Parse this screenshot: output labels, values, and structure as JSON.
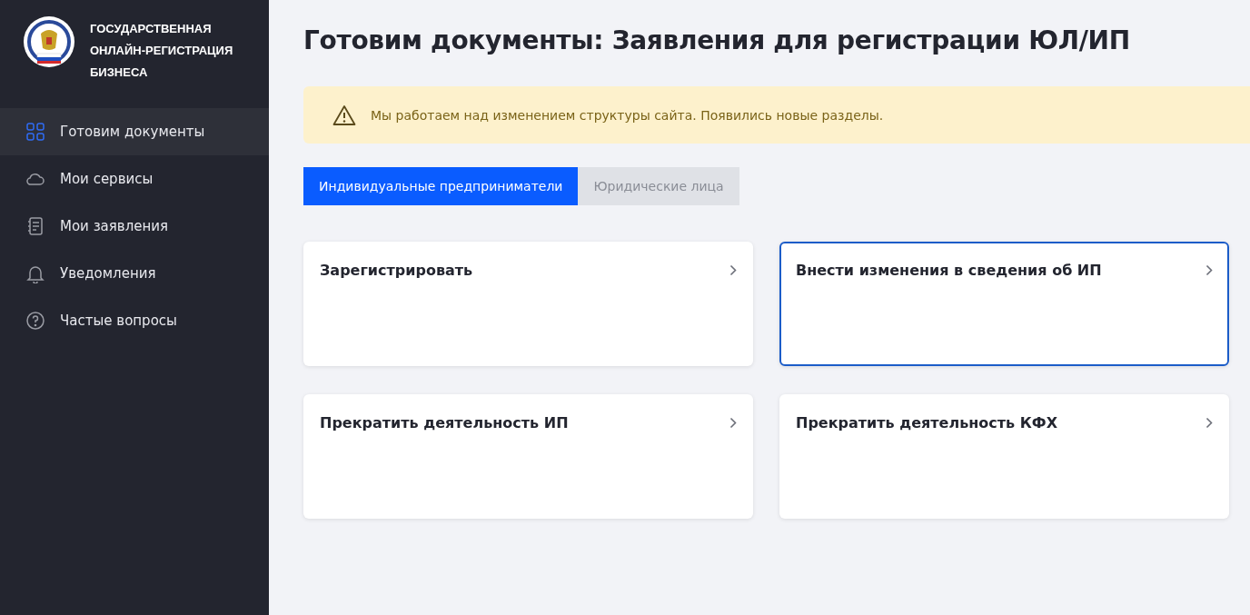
{
  "sidebar": {
    "logo_text": "ГОСУДАРСТВЕННАЯ ОНЛАЙН-РЕГИСТРАЦИЯ БИЗНЕСА",
    "items": [
      {
        "label": "Готовим документы",
        "selected": true
      },
      {
        "label": "Мои сервисы",
        "selected": false
      },
      {
        "label": "Мои заявления",
        "selected": false
      },
      {
        "label": "Уведомления",
        "selected": false
      },
      {
        "label": "Частые вопросы",
        "selected": false
      }
    ]
  },
  "page_title": "Готовим документы: Заявления для регистрации ЮЛ/ИП",
  "notice": "Мы работаем над изменением структуры сайта. Появились новые разделы.",
  "tabs": [
    {
      "label": "Индивидуальные предприниматели",
      "selected": true
    },
    {
      "label": "Юридические лица",
      "selected": false
    }
  ],
  "cards": [
    {
      "title": "Зарегистрировать",
      "highlighted": false
    },
    {
      "title": "Внести изменения в сведения об ИП",
      "highlighted": true
    },
    {
      "title": "Прекратить деятельность ИП",
      "highlighted": false
    },
    {
      "title": "Прекратить деятельность КФХ",
      "highlighted": false
    }
  ]
}
